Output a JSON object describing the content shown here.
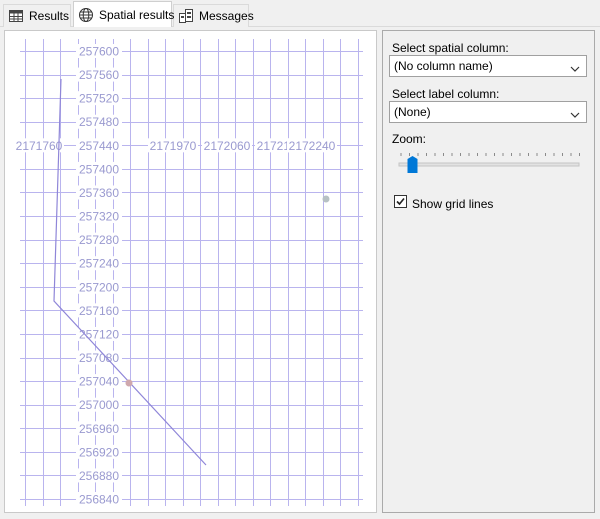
{
  "tabs": [
    {
      "label": "Results",
      "icon": "grid-icon",
      "active": false
    },
    {
      "label": "Spatial results",
      "icon": "globe-icon",
      "active": true
    },
    {
      "label": "Messages",
      "icon": "messages-icon",
      "active": false
    }
  ],
  "plot": {
    "y_labels": [
      "257600",
      "257560",
      "257520",
      "257480",
      "257440",
      "257400",
      "257360",
      "257320",
      "257280",
      "257240",
      "257200",
      "257160",
      "257120",
      "257080",
      "257040",
      "257000",
      "256960",
      "256920",
      "256880",
      "256840"
    ],
    "x_labels": [
      "2171760",
      "2171970",
      "2172060",
      "2172150",
      "2172240"
    ],
    "line_color": "#8f86d8",
    "grid_color": "#b9b4ee",
    "point_colors": [
      "#cfa8ad",
      "#b7c1c4"
    ]
  },
  "panel": {
    "spatial_label": "Select spatial column:",
    "spatial_value": "(No column name)",
    "label_label": "Select label column:",
    "label_value": "(None)",
    "zoom_label": "Zoom:",
    "zoom_level": 0.05,
    "show_grid_label": "Show grid lines",
    "show_grid_checked": true
  }
}
